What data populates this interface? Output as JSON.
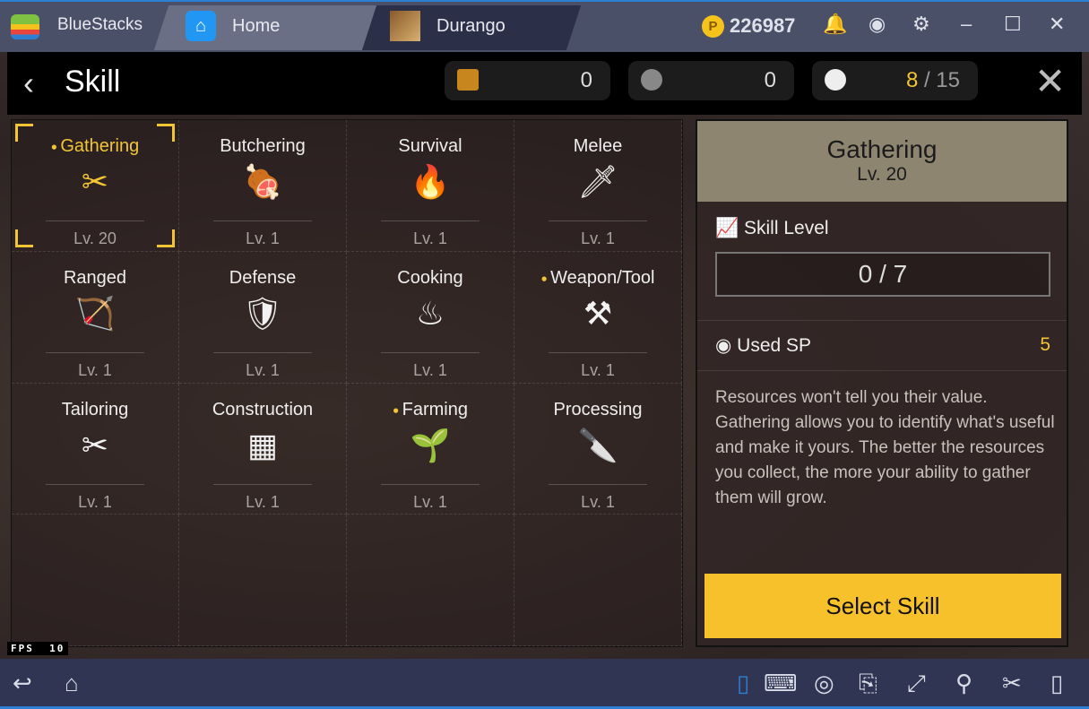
{
  "titlebar": {
    "brand": "BlueStacks",
    "tabs": [
      {
        "label": "Home",
        "icon": "home-icon"
      },
      {
        "label": "Durango",
        "icon": "durango-app-icon"
      }
    ],
    "coins": "226987"
  },
  "header": {
    "title": "Skill",
    "currency1": "0",
    "currency2": "0",
    "sp_used": "8",
    "sp_total": "/ 15"
  },
  "skills": [
    {
      "name": "Gathering",
      "level": "Lv. 20",
      "icon": "✂",
      "selected": true,
      "dot": true
    },
    {
      "name": "Butchering",
      "level": "Lv. 1",
      "icon": "🍖"
    },
    {
      "name": "Survival",
      "level": "Lv. 1",
      "icon": "🔥"
    },
    {
      "name": "Melee",
      "level": "Lv. 1",
      "icon": "🗡"
    },
    {
      "name": "Ranged",
      "level": "Lv. 1",
      "icon": "🏹"
    },
    {
      "name": "Defense",
      "level": "Lv. 1",
      "icon": "🛡"
    },
    {
      "name": "Cooking",
      "level": "Lv. 1",
      "icon": "♨"
    },
    {
      "name": "Weapon/Tool",
      "level": "Lv. 1",
      "icon": "⚒",
      "dot": true
    },
    {
      "name": "Tailoring",
      "level": "Lv. 1",
      "icon": "✂"
    },
    {
      "name": "Construction",
      "level": "Lv. 1",
      "icon": "▦"
    },
    {
      "name": "Farming",
      "level": "Lv. 1",
      "icon": "🌱",
      "dot": true
    },
    {
      "name": "Processing",
      "level": "Lv. 1",
      "icon": "🔪"
    }
  ],
  "detail": {
    "title": "Gathering",
    "level": "Lv. 20",
    "skill_level_label": "Skill Level",
    "skill_level_value": "0 / 7",
    "used_sp_label": "Used SP",
    "used_sp_value": "5",
    "description": "Resources won't tell you their value. Gathering allows you to identify what's useful and make it yours. The better the resources you collect, the more your ability to gather them will grow.",
    "select_button": "Select Skill"
  },
  "fps": {
    "label": "FPS",
    "value": "10"
  },
  "colors": {
    "accent": "#f3c535",
    "button": "#f6c12b",
    "titlebar": "#4b5069"
  }
}
